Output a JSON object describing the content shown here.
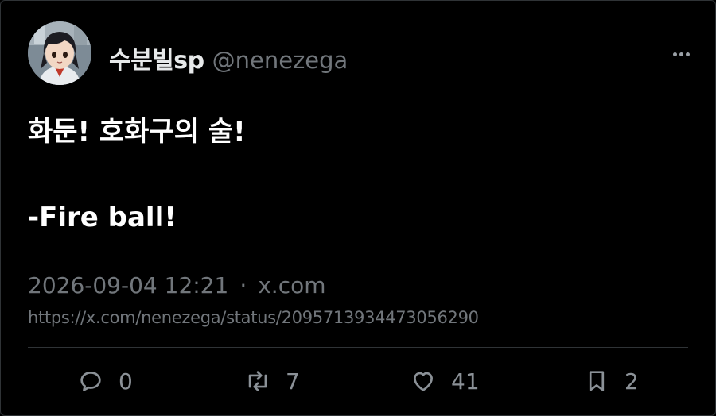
{
  "author": {
    "display_name": "수분빌sp",
    "handle": "@nenezega"
  },
  "tweet": {
    "text": "화둔! 호화구의 술!\n\n-Fire ball!"
  },
  "meta": {
    "timestamp": "2026-09-04 12:21",
    "separator": "·",
    "source": "x.com",
    "url": "https://x.com/nenezega/status/2095713934473056290"
  },
  "actions": {
    "reply_count": "0",
    "repost_count": "7",
    "like_count": "41",
    "bookmark_count": "2"
  },
  "icons": {
    "more": "more-icon",
    "reply": "reply-icon",
    "repost": "repost-icon",
    "like": "heart-icon",
    "bookmark": "bookmark-icon"
  },
  "colors": {
    "background": "#000000",
    "text_primary": "#e7e9ea",
    "text_secondary": "#71767b",
    "divider": "#2f3336"
  }
}
